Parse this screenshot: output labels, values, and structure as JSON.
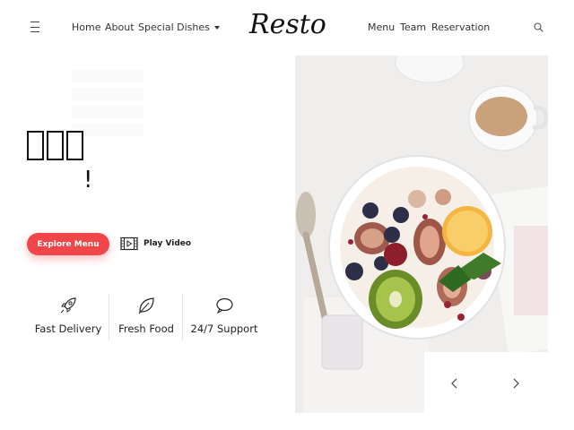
{
  "nav": {
    "menu_icon": "hamburger-icon",
    "links_left": [
      "Home",
      "About",
      "Special Dishes"
    ],
    "brand": "Resto",
    "links_right": [
      "Menu",
      "Team",
      "Reservation"
    ],
    "search_icon": "search-icon"
  },
  "hero": {
    "title_glyphs": "▯▯▯",
    "exclamation": "!",
    "explore_label": "Explore Menu",
    "play_label": "Play Video",
    "play_icon": "film-icon"
  },
  "features": [
    {
      "icon": "rocket-icon",
      "label": "Fast Delivery"
    },
    {
      "icon": "leaf-icon",
      "label": "Fresh Food"
    },
    {
      "icon": "chat-bubble-icon",
      "label": "24/7 Support"
    }
  ],
  "slider": {
    "prev_icon": "chevron-left-icon",
    "next_icon": "chevron-right-icon"
  },
  "colors": {
    "accent": "#f0464a",
    "text": "#222222"
  }
}
